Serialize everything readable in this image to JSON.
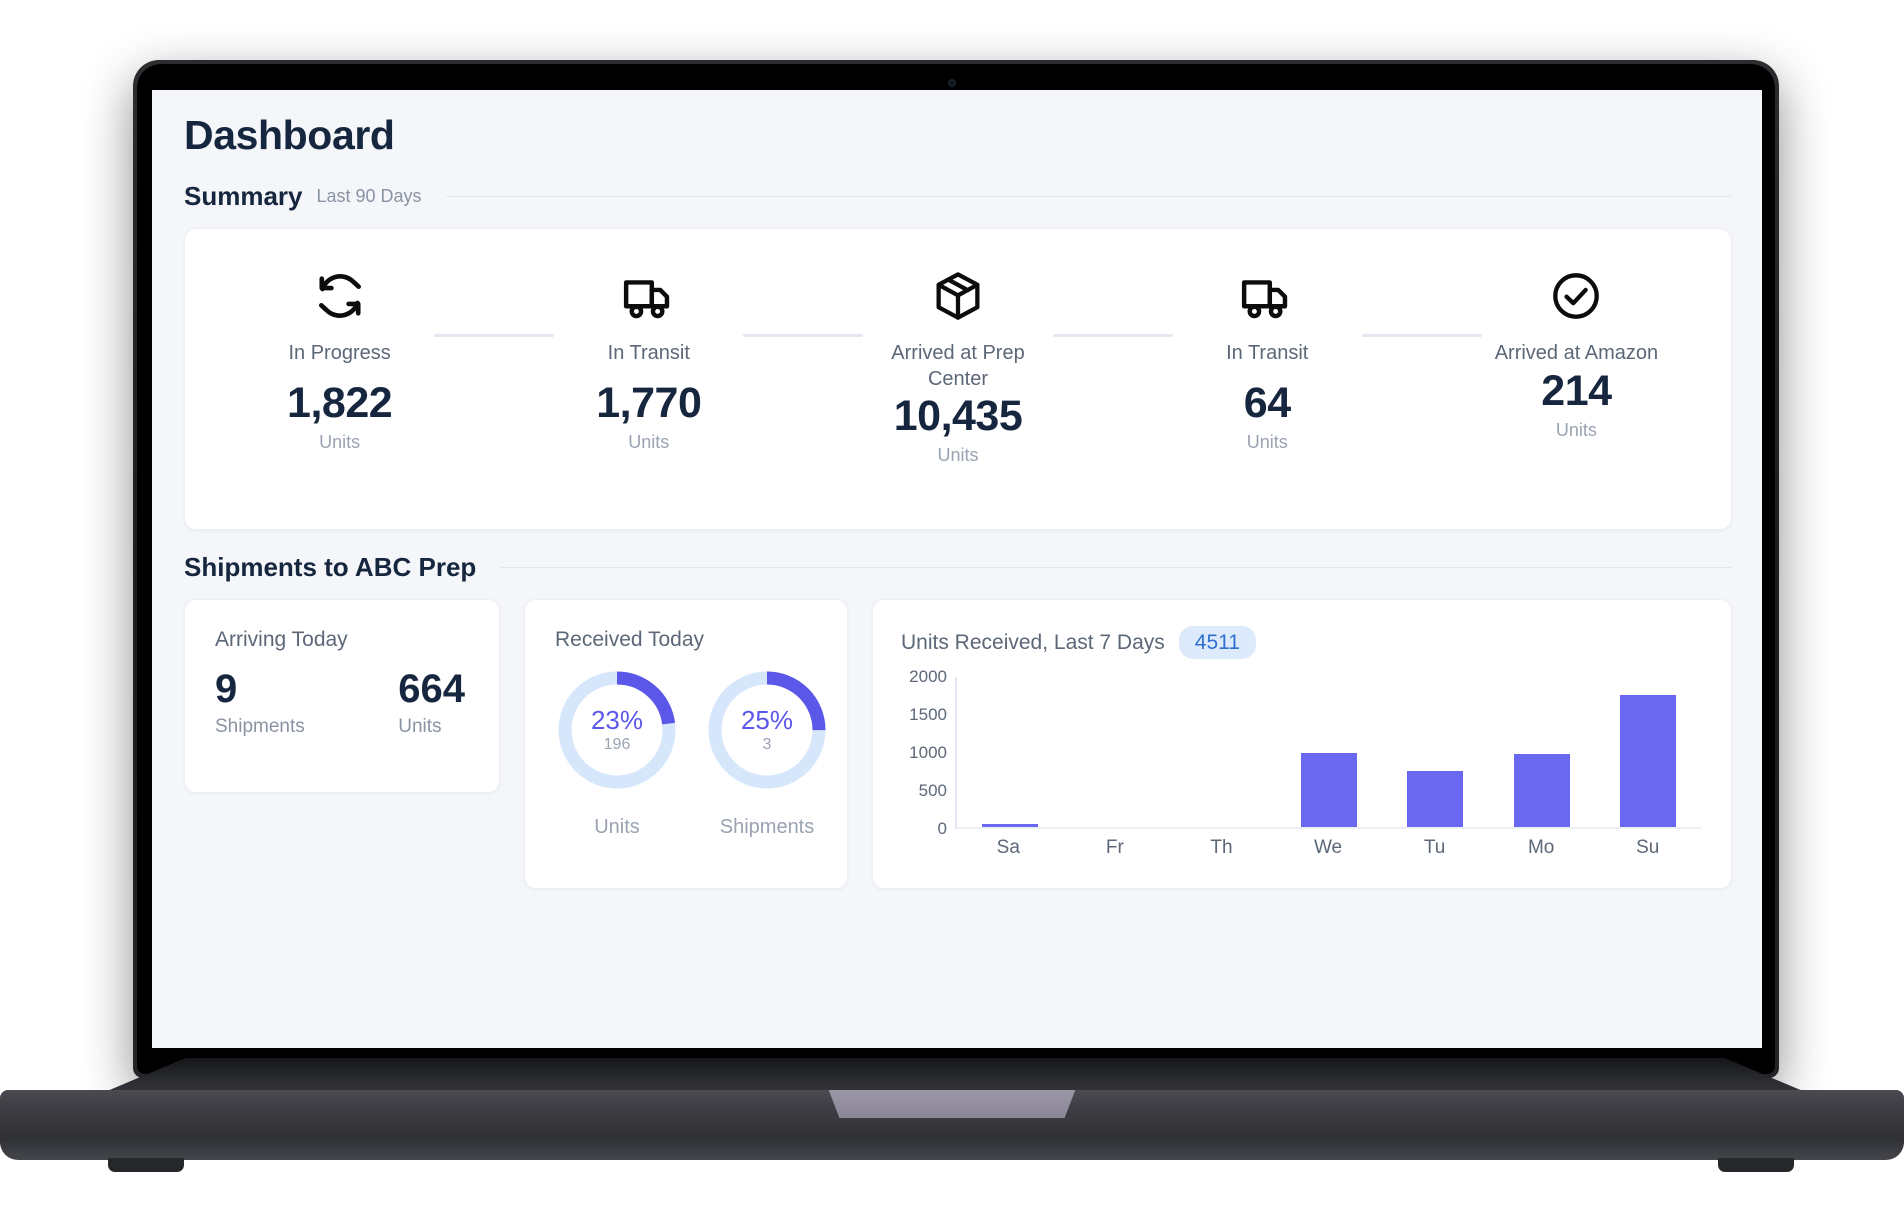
{
  "page": {
    "title": "Dashboard"
  },
  "summary": {
    "title": "Summary",
    "subtitle": "Last 90 Days",
    "items": [
      {
        "icon": "refresh-icon",
        "label": "In Progress",
        "value": "1,822",
        "units": "Units"
      },
      {
        "icon": "truck-icon",
        "label": "In Transit",
        "value": "1,770",
        "units": "Units"
      },
      {
        "icon": "package-icon",
        "label": "Arrived at Prep Center",
        "value": "10,435",
        "units": "Units"
      },
      {
        "icon": "truck-icon",
        "label": "In Transit",
        "value": "64",
        "units": "Units"
      },
      {
        "icon": "check-circle-icon",
        "label": "Arrived at Amazon",
        "value": "214",
        "units": "Units"
      }
    ]
  },
  "shipments": {
    "title": "Shipments to ABC Prep",
    "arriving": {
      "heading": "Arriving Today",
      "shipments_value": "9",
      "shipments_caption": "Shipments",
      "units_value": "664",
      "units_caption": "Units"
    },
    "received": {
      "heading": "Received Today",
      "donuts": [
        {
          "percent_label": "23%",
          "percent": 23,
          "sub": "196",
          "caption": "Units"
        },
        {
          "percent_label": "25%",
          "percent": 25,
          "sub": "3",
          "caption": "Shipments"
        }
      ]
    }
  },
  "colors": {
    "accent_purple": "#6a67f0",
    "donut_purple": "#5b57e8",
    "donut_track": "#d6e6fb",
    "badge_bg": "#ddeafc",
    "badge_text": "#2f6fd0",
    "heading_navy": "#16263f",
    "muted_gray": "#8a93a3",
    "screen_bg": "#f4f6f9"
  },
  "chart_data": {
    "type": "bar",
    "title": "Units Received, Last 7 Days",
    "badge": "4511",
    "categories": [
      "Sa",
      "Fr",
      "Th",
      "We",
      "Tu",
      "Mo",
      "Su"
    ],
    "values": [
      35,
      0,
      0,
      990,
      745,
      980,
      1760
    ],
    "xlabel": "",
    "ylabel": "",
    "ylim": [
      0,
      2000
    ],
    "yticks": [
      2000,
      1500,
      1000,
      500,
      0
    ],
    "grid": false,
    "legend": "none",
    "series_color": "#6a67f0"
  }
}
